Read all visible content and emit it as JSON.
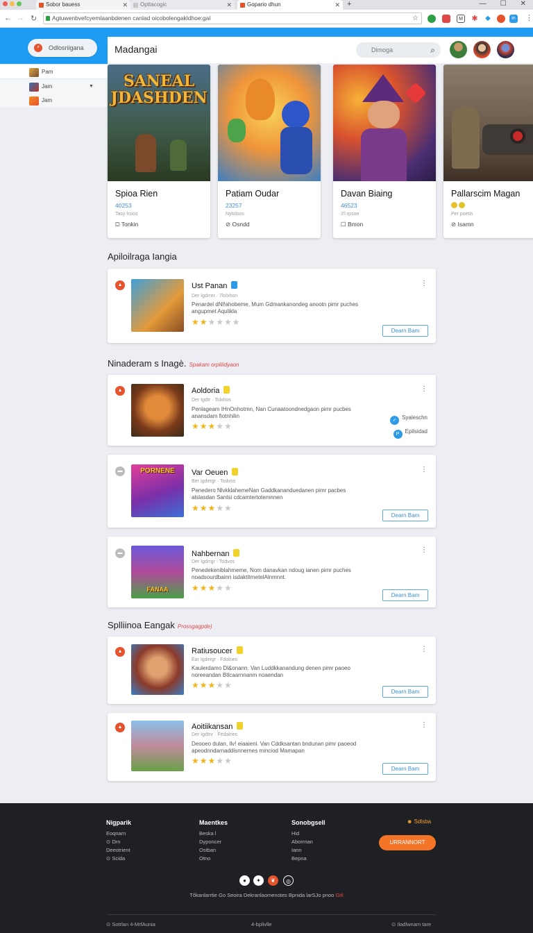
{
  "browser": {
    "tabs": [
      {
        "label": "Sobor bauess"
      },
      {
        "label": "Opttacogic"
      },
      {
        "label": "Gopario dhun"
      }
    ],
    "url": "Agtuwenbvefcyemlaanbdenen canlad oicobolengakldhoe:gal",
    "new_tab": "+",
    "window_controls": [
      "—",
      "☐",
      "✕"
    ]
  },
  "app": {
    "accent": "#1e9cf3",
    "sidebar_button": "Odlosriigana",
    "sidebar_items": [
      {
        "label": "Pam"
      },
      {
        "label": "Jam"
      },
      {
        "label": "Jam"
      }
    ],
    "title": "Madangai",
    "search_placeholder": "Dimoga"
  },
  "featured": [
    {
      "name": "Spioa Rien",
      "number": "40253",
      "sub": "Tasy hsios",
      "meta": "Tonkin",
      "art": "SANEAL JDASHDEN"
    },
    {
      "name": "Patiam Oudar",
      "number": "23257",
      "sub": "Nytolsos",
      "meta": "Osndd"
    },
    {
      "name": "Davan Biaing",
      "number": "46523",
      "sub": "3'l rpsoe",
      "meta": "Bmon"
    },
    {
      "name": "Pallarscim Magan",
      "number": "",
      "sub": "Per poetis",
      "meta": "Isamn"
    }
  ],
  "sections": [
    {
      "title": "Apiloilraga Iangia",
      "note": ""
    },
    {
      "title": "Ninaderam s Inagè.",
      "note": "Spakam orpliiidyaon"
    },
    {
      "title": "Splliinoa Eangak",
      "note": "Prossgagpde)"
    }
  ],
  "list_items": [
    {
      "title": "Ust Panan",
      "sub": "Der  Igdrrer · 7lolxhon",
      "desc1": "Penardel dNl!ahobeme, Mum Gdmankanondeg anootn pimr puches",
      "desc2": "angupmet Aqulikla",
      "rating": 2,
      "button": "Dearn Bam",
      "badge": "▲",
      "badge_color": "#e5532d"
    },
    {
      "title": "Aoldoria",
      "sub": "Der  Igdtr · Tolxhos",
      "desc1": "Penlageam IHnOnhotmn, Nan Cunaatoondnedgaon pimr pucbes",
      "desc2": "anansdam fiotnhilin",
      "rating": 3,
      "side1": "Syaleschn",
      "side2": "Epilsidad",
      "badge": "▲",
      "badge_color": "#e5532d"
    },
    {
      "title": "Var Oeuen",
      "sub": "Ber  Igdergr · Todvos",
      "desc1": "Penedero NlvkklahemeNan Gaddkananduedanen pimr pacbes",
      "desc2": "alslasdan Santsi cdcamtertotemnnen",
      "rating": 3,
      "button": "Dearn Bam",
      "badge": "▬",
      "badge_color": "#bbbbbb",
      "art": "PORNENE"
    },
    {
      "title": "Nahbernan",
      "sub": "Der  Igdrrgr · Todvos",
      "desc1": "Penedekeniblahmeme, Nom danavkan ndoug ianen pimr puches",
      "desc2": "noadsourdbainn isdaktitrnetelAlnmnnt.",
      "rating": 3,
      "button": "Dearn Bam",
      "badge": "▬",
      "badge_color": "#bbbbbb",
      "art": "FANAA"
    },
    {
      "title": "Ratiusoucer",
      "sub": "Ear  Igdergr · Fdolnes",
      "desc1": "Kaulerdamo Dl&onann. Van Luddkkanandung denen pimr paoeo",
      "desc2": "noreeandan Btlcaarnnanm noaendan",
      "rating": 3,
      "button": "Dearn Bam",
      "badge": "▲",
      "badge_color": "#e5532d"
    },
    {
      "title": "Aoitiikansan",
      "sub": "Der  Igdtnr · Fedalnes",
      "desc1": "Deooeo dulan, Ilv! eiaaieni. Van Cddksantan bndunan pimr paoeod",
      "desc2": "apeodnndarnaddisnnernes minciod Mamapan",
      "rating": 3,
      "button": "Dearn Bam",
      "badge": "▲",
      "badge_color": "#e5532d"
    }
  ],
  "footer": {
    "cols": [
      {
        "title": "Nigparik",
        "items": [
          "Eoqnarn",
          "⊙ Drn",
          "Deeotrient",
          "⊙ Scida"
        ]
      },
      {
        "title": "Maentkes",
        "items": [
          "Beska l",
          "Dyponcer",
          "Ostban",
          "Otno"
        ]
      },
      {
        "title": "Sonobgsell",
        "items": [
          "Hid",
          "Aborrnan",
          "Iann",
          "Bepna"
        ]
      }
    ],
    "tag": "☻ Sdlsba",
    "cta": "URRANNORT",
    "social": [
      "●",
      "✦",
      "❦",
      "◎"
    ],
    "line": "Tôkanlarrtie Go Seoira Dekranlaomenotes Bpnida larSJo pnoo",
    "line_red": "Gitl",
    "bottom_left": "⊙ Sotrlan 4-MrfAunia",
    "bottom_mid": "4-bplivlle",
    "bottom_right": "⊙ Iladlwnam tare"
  }
}
